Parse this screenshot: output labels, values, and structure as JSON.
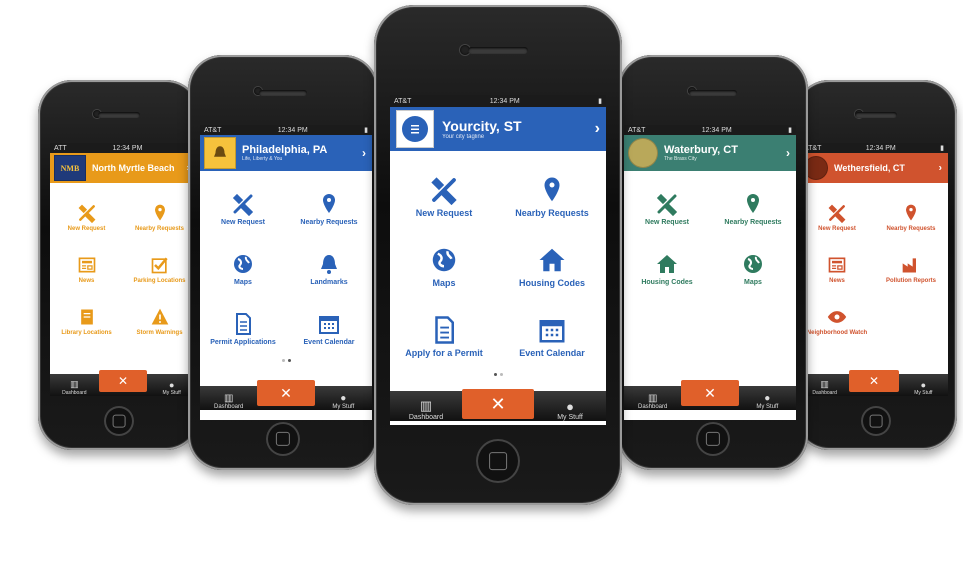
{
  "colors": {
    "blue": "#2a62b8",
    "orange": "#e0602a",
    "amber": "#e89a1a",
    "green": "#3b7f72",
    "rust": "#d0532e",
    "iconBlue": "#2a62b8",
    "iconAmber": "#e89a1a",
    "iconGreen": "#2f7b5f",
    "iconRust": "#d0532e"
  },
  "phones": [
    {
      "id": "p1",
      "carrier": "ATT",
      "time": "12:34 PM",
      "city": "North Myrtle Beach",
      "subtitle": "",
      "seal_text": "NMB",
      "tiles": [
        {
          "icon": "tools-icon",
          "label": "New Request"
        },
        {
          "icon": "pin-icon",
          "label": "Nearby Requests"
        },
        {
          "icon": "news-icon",
          "label": "News"
        },
        {
          "icon": "check-icon",
          "label": "Parking Locations"
        },
        {
          "icon": "book-icon",
          "label": "Library Locations"
        },
        {
          "icon": "warning-icon",
          "label": "Storm Warnings"
        }
      ],
      "tabs": {
        "left": "Dashboard",
        "right": "My Stuff"
      }
    },
    {
      "id": "p2",
      "carrier": "AT&T",
      "time": "12:34 PM",
      "city": "Philadelphia, PA",
      "subtitle": "Life, Liberty & You",
      "tiles": [
        {
          "icon": "tools-icon",
          "label": "New Request"
        },
        {
          "icon": "pin-icon",
          "label": "Nearby Requests"
        },
        {
          "icon": "globe-icon",
          "label": "Maps"
        },
        {
          "icon": "bell-icon",
          "label": "Landmarks"
        },
        {
          "icon": "doc-icon",
          "label": "Permit Applications"
        },
        {
          "icon": "calendar-icon",
          "label": "Event Calendar"
        }
      ],
      "tabs": {
        "left": "Dashboard",
        "right": "My Stuff"
      }
    },
    {
      "id": "p3",
      "carrier": "AT&T",
      "time": "12:34 PM",
      "city": "Yourcity, ST",
      "subtitle": "Your city tagline",
      "tiles": [
        {
          "icon": "tools-icon",
          "label": "New Request"
        },
        {
          "icon": "pin-icon",
          "label": "Nearby Requests"
        },
        {
          "icon": "globe-icon",
          "label": "Maps"
        },
        {
          "icon": "house-icon",
          "label": "Housing Codes"
        },
        {
          "icon": "doc-icon",
          "label": "Apply for a Permit"
        },
        {
          "icon": "calendar-icon",
          "label": "Event Calendar"
        }
      ],
      "tabs": {
        "left": "Dashboard",
        "right": "My Stuff"
      }
    },
    {
      "id": "p4",
      "carrier": "AT&T",
      "time": "12:34 PM",
      "city": "Waterbury, CT",
      "subtitle": "The Brass City",
      "tiles": [
        {
          "icon": "tools-icon",
          "label": "New Request"
        },
        {
          "icon": "pin-icon",
          "label": "Nearby Requests"
        },
        {
          "icon": "house-icon",
          "label": "Housing Codes"
        },
        {
          "icon": "globe-icon",
          "label": "Maps"
        }
      ],
      "tabs": {
        "left": "Dashboard",
        "right": "My Stuff"
      }
    },
    {
      "id": "p5",
      "carrier": "AT&T",
      "time": "12:34 PM",
      "city": "Wethersfield, CT",
      "subtitle": "",
      "tiles": [
        {
          "icon": "tools-icon",
          "label": "New Request"
        },
        {
          "icon": "pin-icon",
          "label": "Nearby Requests"
        },
        {
          "icon": "news-icon",
          "label": "News"
        },
        {
          "icon": "factory-icon",
          "label": "Pollution Reports"
        },
        {
          "icon": "eye-icon",
          "label": "Neighborhood Watch"
        }
      ],
      "tabs": {
        "left": "Dashboard",
        "right": "My Stuff"
      }
    }
  ]
}
